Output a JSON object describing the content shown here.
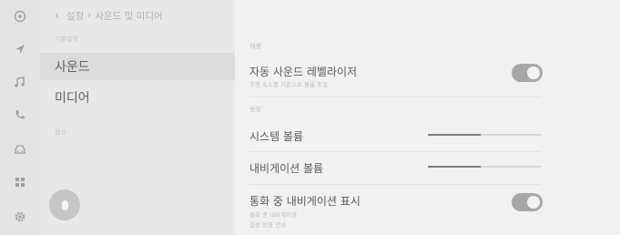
{
  "breadcrumb": {
    "back_icon": "back-chevron-icon",
    "parts": [
      "설정",
      "사운드 및 미디어"
    ],
    "separator": "›"
  },
  "rail_icons": [
    "media-icon",
    "navigation-icon",
    "music-icon",
    "phone-icon",
    "car-icon",
    "apps-icon",
    "settings-icon"
  ],
  "menu": {
    "section_basic": "기본설정",
    "items": [
      {
        "label": "사운드",
        "selected": true
      },
      {
        "label": "미디어",
        "selected": false
      }
    ],
    "section_other": "음성"
  },
  "content": {
    "group1_label": "재생",
    "auto_leveler": {
      "title": "자동 사운드 레벨라이저",
      "subtitle": "주행 속도를 기준으로 볼륨 조절",
      "on": true
    },
    "group2_label": "음성",
    "system_volume": {
      "title": "시스템 볼륨",
      "level": 0.47
    },
    "nav_volume": {
      "title": "내비게이션 볼륨",
      "level": 0.47
    },
    "call_nav": {
      "title": "통화 중 내비게이션 표시",
      "subtitle1": "통화 중 내비게이션",
      "subtitle2": "음성 방향 안내",
      "on": true
    }
  },
  "colors": {
    "accent": "#a7a7a7",
    "background": "#efefef"
  }
}
